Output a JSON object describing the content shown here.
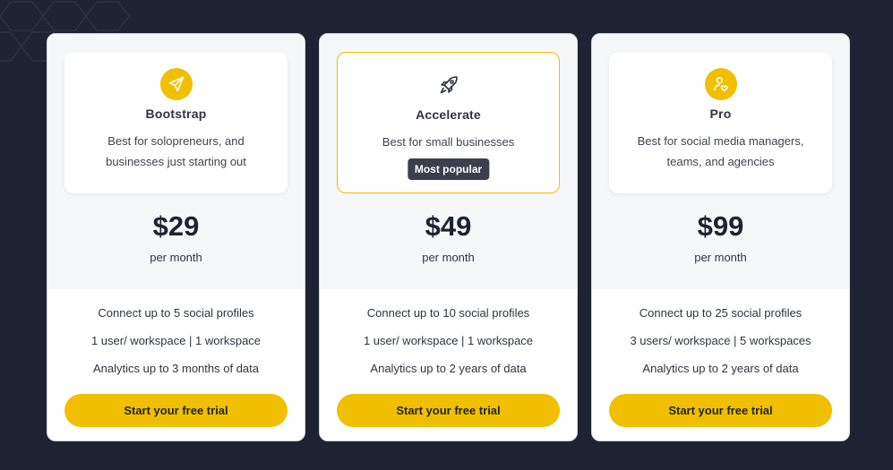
{
  "colors": {
    "background": "#1f2231",
    "accent": "#f0c000",
    "badge": "#3b3f4c"
  },
  "plans": [
    {
      "icon": "paper-plane-icon",
      "name": "Bootstrap",
      "description": "Best for solopreneurs, and businesses just starting out",
      "price": "$29",
      "period": "per month",
      "features": [
        "Connect up to 5 social profiles",
        "1 user/ workspace | 1 workspace",
        "Analytics up to 3 months of data"
      ],
      "cta": "Start your free trial"
    },
    {
      "icon": "rocket-icon",
      "name": "Accelerate",
      "description": "Best for small businesses",
      "badge": "Most popular",
      "price": "$49",
      "period": "per month",
      "features": [
        "Connect up to 10 social profiles",
        "1 user/ workspace | 1 workspace",
        "Analytics up to 2 years of data"
      ],
      "cta": "Start your free trial"
    },
    {
      "icon": "user-heart-icon",
      "name": "Pro",
      "description": "Best for social media managers, teams, and agencies",
      "price": "$99",
      "period": "per month",
      "features": [
        "Connect up to 25 social profiles",
        "3 users/ workspace | 5 workspaces",
        "Analytics up to 2 years of data"
      ],
      "cta": "Start your free trial"
    }
  ]
}
